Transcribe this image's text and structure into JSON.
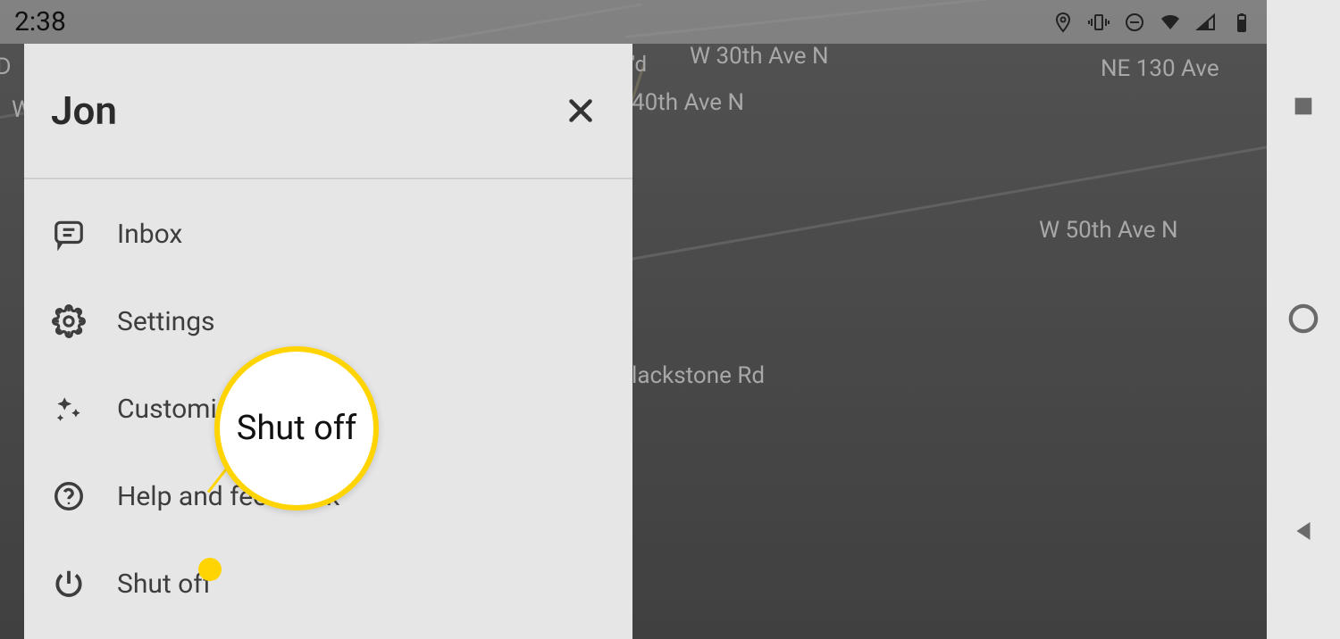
{
  "status": {
    "time": "2:38"
  },
  "drawer": {
    "title": "Jon",
    "items": [
      {
        "icon": "inbox",
        "label": "Inbox"
      },
      {
        "icon": "settings",
        "label": "Settings"
      },
      {
        "icon": "customize",
        "label": "Customize"
      },
      {
        "icon": "help",
        "label": "Help and feedback"
      },
      {
        "icon": "power",
        "label": "Shut off"
      }
    ]
  },
  "map": {
    "labels": {
      "l1": "I D",
      "l2": "W",
      "l3": "W 30th Ave N",
      "l4": "40th Ave N",
      "l5": "NE 130 Ave",
      "l6": "W 50th Ave N",
      "l7": "lackstone Rd",
      "l8": "'d"
    }
  },
  "callout": {
    "text": "Shut off"
  }
}
